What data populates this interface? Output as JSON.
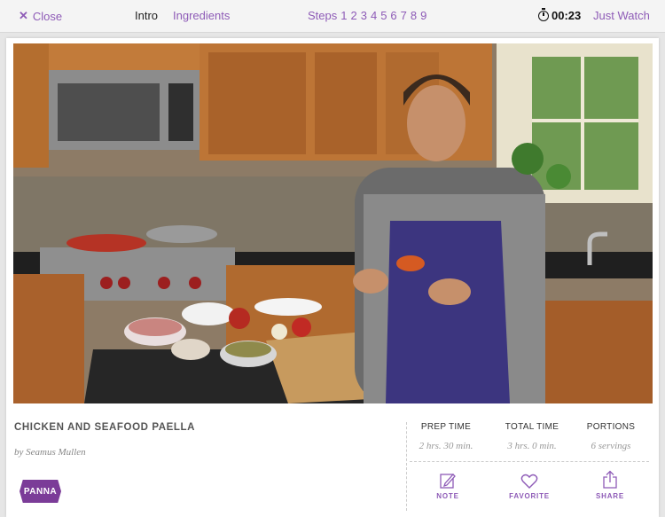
{
  "topbar": {
    "close_label": "Close",
    "tabs": [
      {
        "label": "Intro",
        "active": true
      },
      {
        "label": "Ingredients",
        "active": false
      }
    ],
    "steps_label": "Steps",
    "steps": [
      "1",
      "2",
      "3",
      "4",
      "5",
      "6",
      "7",
      "8",
      "9"
    ],
    "timer": "00:23",
    "just_watch_label": "Just Watch"
  },
  "recipe": {
    "title": "CHICKEN AND SEAFOOD PAELLA",
    "author": "by Seamus Mullen",
    "brand": "PANNA"
  },
  "stats": [
    {
      "label": "PREP TIME",
      "value": "2 hrs. 30 min."
    },
    {
      "label": "TOTAL TIME",
      "value": "3 hrs.  0 min."
    },
    {
      "label": "PORTIONS",
      "value": "6 servings"
    }
  ],
  "actions": [
    {
      "label": "NOTE",
      "icon": "pencil-note-icon"
    },
    {
      "label": "FAVORITE",
      "icon": "heart-icon"
    },
    {
      "label": "SHARE",
      "icon": "share-icon"
    }
  ],
  "colors": {
    "accent": "#8e5bb7",
    "brand": "#7b3c98"
  }
}
